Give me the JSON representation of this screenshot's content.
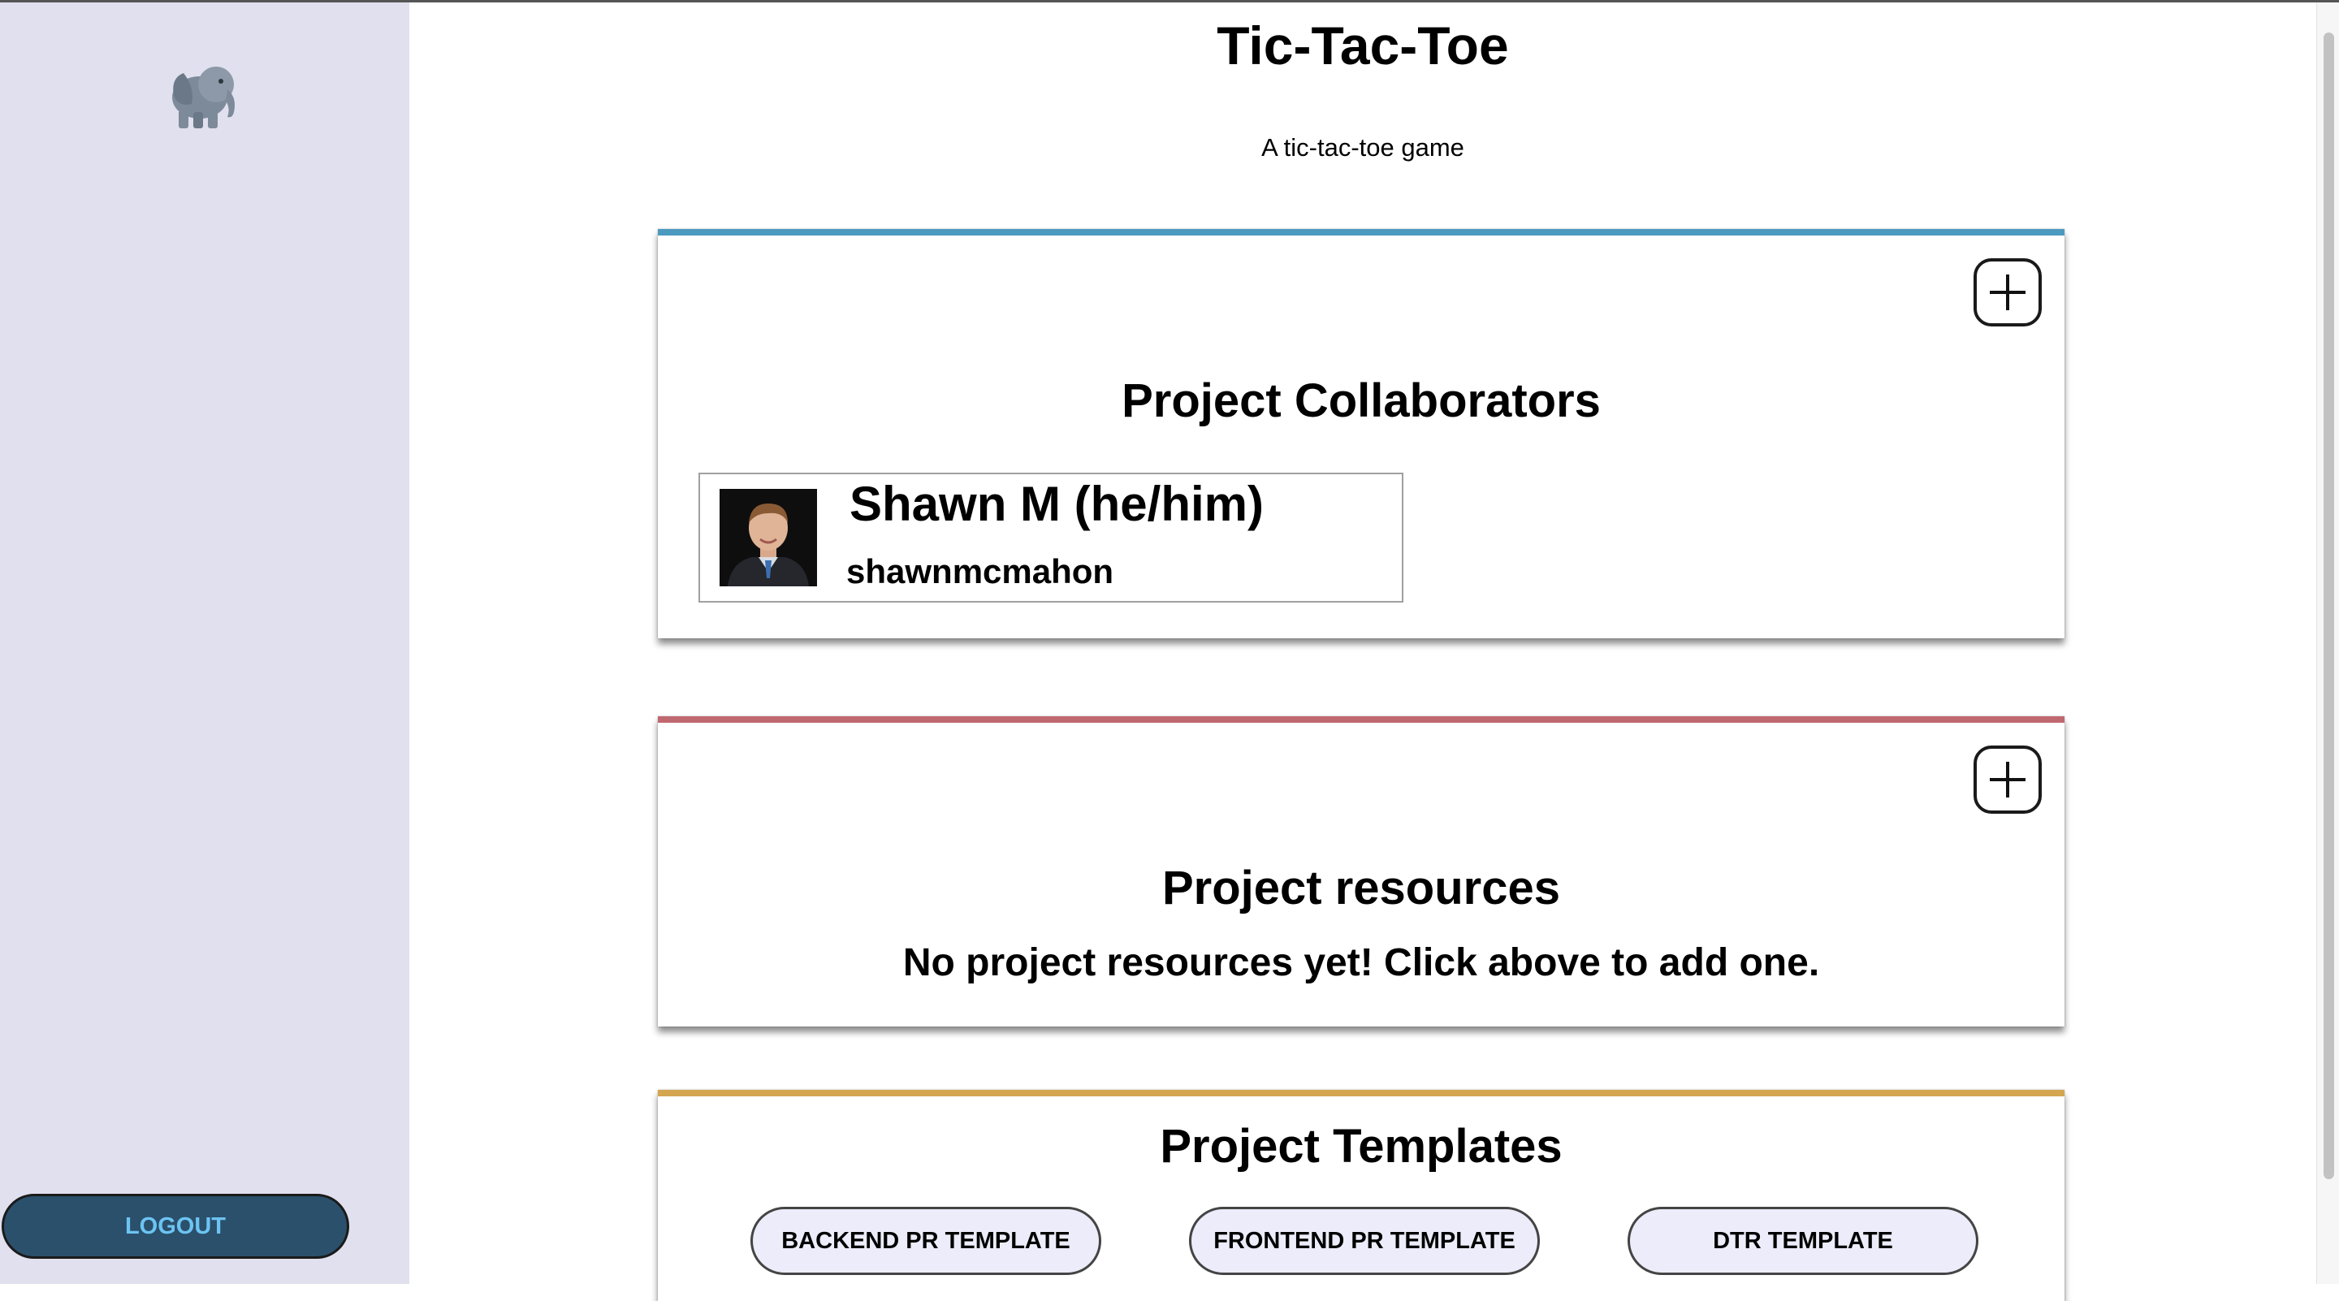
{
  "sidebar": {
    "logo_icon": "elephant-icon",
    "logout_label": "LOGOUT"
  },
  "header": {
    "title": "Tic-Tac-Toe",
    "subtitle": "A tic-tac-toe game"
  },
  "collaborators": {
    "title": "Project Collaborators",
    "add_icon": "plus-icon",
    "accent_color": "#4c9ac0",
    "items": [
      {
        "name": "Shawn M (he/him)",
        "username": "shawnmcmahon",
        "avatar_icon": "avatar-photo"
      }
    ]
  },
  "resources": {
    "title": "Project resources",
    "add_icon": "plus-icon",
    "accent_color": "#c06870",
    "empty_message": "No project resources yet! Click above to add one."
  },
  "templates": {
    "title": "Project Templates",
    "accent_color": "#d4a650",
    "buttons": [
      {
        "label": "BACKEND PR TEMPLATE"
      },
      {
        "label": "FRONTEND PR TEMPLATE"
      },
      {
        "label": "DTR TEMPLATE"
      }
    ]
  },
  "colors": {
    "sidebar_bg": "#e0e0ee",
    "logout_bg": "#2b506c",
    "logout_text": "#6cc4f2",
    "template_button_bg": "#ececfa"
  }
}
